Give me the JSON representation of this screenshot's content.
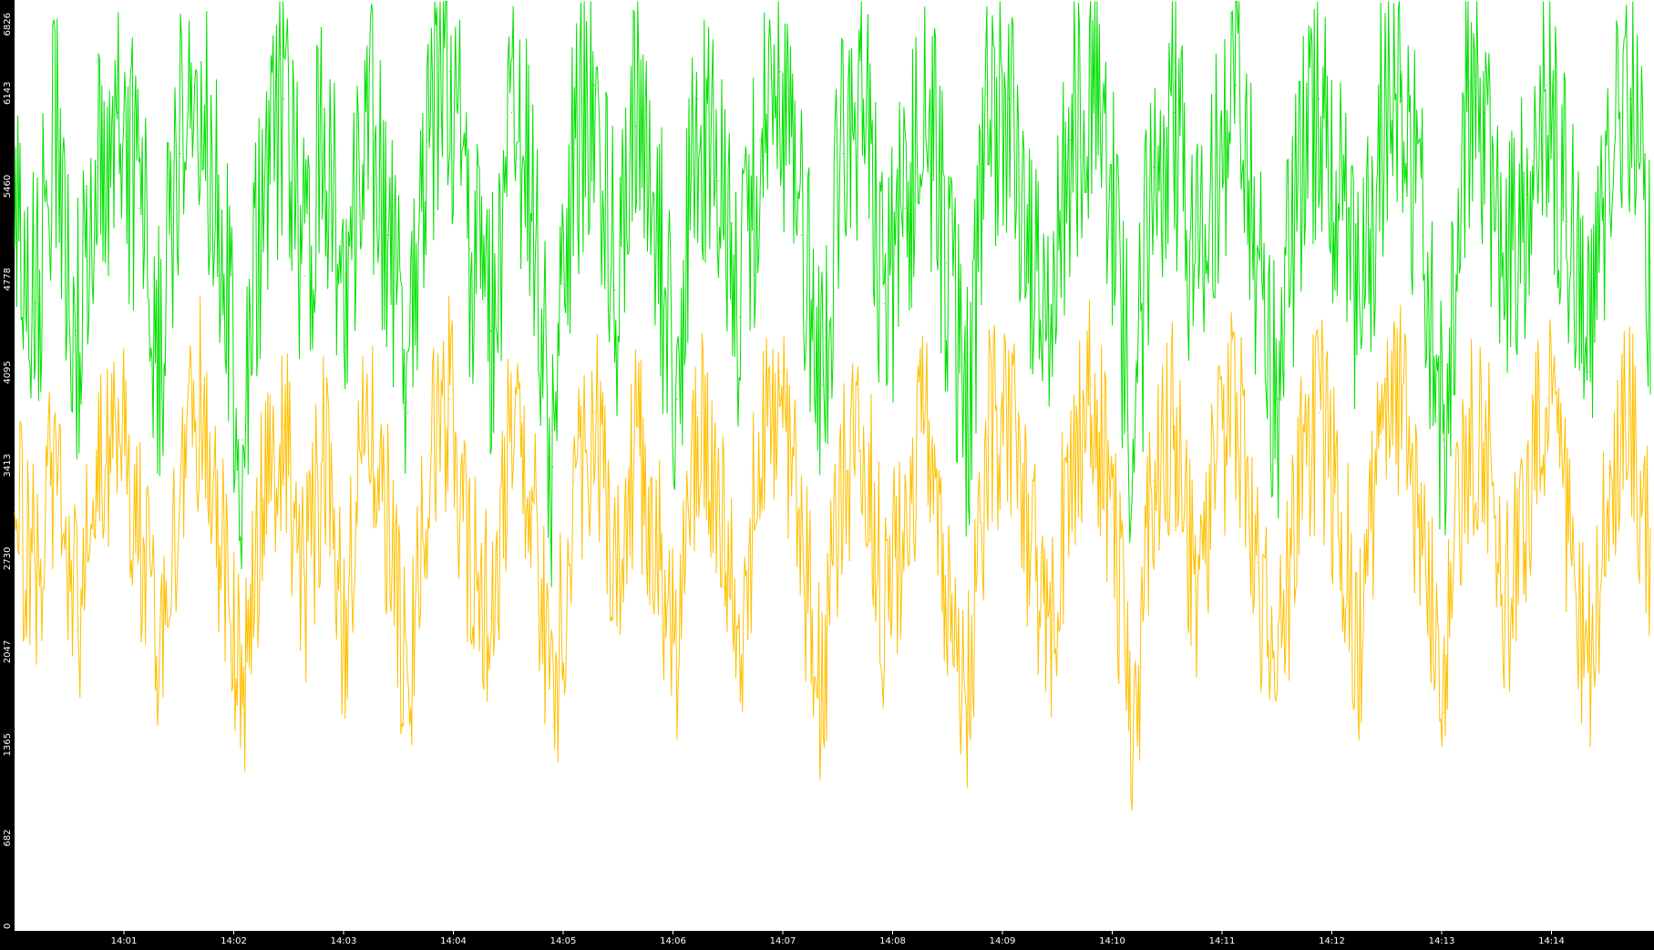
{
  "chart_data": {
    "type": "line",
    "title": "",
    "xlabel": "",
    "ylabel": "",
    "ylim": [
      0,
      6826
    ],
    "y_ticks": [
      "0",
      "682",
      "1365",
      "2047",
      "2730",
      "3413",
      "4095",
      "4778",
      "5460",
      "6143",
      "6826"
    ],
    "x_ticks": [
      "14:01",
      "14:02",
      "14:03",
      "14:04",
      "14:05",
      "14:06",
      "14:07",
      "14:08",
      "14:09",
      "14:10",
      "14:11",
      "14:12",
      "14:13",
      "14:14"
    ],
    "x_range_minutes": [
      14.0,
      14.9
    ],
    "grid": false,
    "legend": "none",
    "background_color": "#000000",
    "plot_background_color": "#ffffff",
    "series": [
      {
        "color": "#00e000",
        "description_values": [
          5200,
          4600,
          5900,
          4400,
          5600,
          6000,
          5300,
          4200,
          5700,
          6300,
          5000,
          3600,
          5500,
          6100,
          4800,
          5900,
          4300,
          6200,
          5100,
          3800,
          5800,
          6300,
          5000,
          4400,
          6000,
          5400,
          3400,
          5600,
          6200,
          4700,
          5900,
          5200,
          3900,
          6100,
          5500,
          4500,
          5800,
          6300,
          5100,
          4000,
          5700,
          6000,
          4600,
          5300,
          6200,
          4900,
          3700,
          5900,
          6100,
          5200,
          4300,
          5800,
          6300,
          5400,
          3500,
          5600,
          6000,
          4800,
          5700,
          6200,
          5000,
          3900,
          5500,
          6100,
          5300,
          4400,
          5900,
          6300,
          5100,
          3600,
          5800,
          6000,
          4700,
          5400,
          6200,
          5200,
          4100,
          5700,
          6100,
          4900
        ]
      },
      {
        "color": "#ffc000",
        "description_values": [
          3100,
          2600,
          3500,
          2200,
          3300,
          3800,
          2900,
          1900,
          3400,
          3900,
          2800,
          1600,
          3200,
          3700,
          2500,
          3600,
          2100,
          4000,
          3000,
          1800,
          3500,
          3900,
          2700,
          2300,
          3700,
          3100,
          1500,
          3300,
          3800,
          2400,
          3600,
          2900,
          1900,
          3800,
          3200,
          2200,
          3500,
          4100,
          2800,
          1700,
          3400,
          3700,
          2300,
          3000,
          3900,
          2600,
          1600,
          3600,
          3800,
          2900,
          2000,
          3500,
          4000,
          3100,
          1400,
          3300,
          3700,
          2500,
          3400,
          3900,
          2700,
          1800,
          3200,
          3800,
          3000,
          2100,
          3600,
          4000,
          2800,
          1600,
          3500,
          3700,
          2400,
          3100,
          3900,
          2900,
          1900,
          3400,
          3800,
          2600
        ]
      }
    ]
  }
}
